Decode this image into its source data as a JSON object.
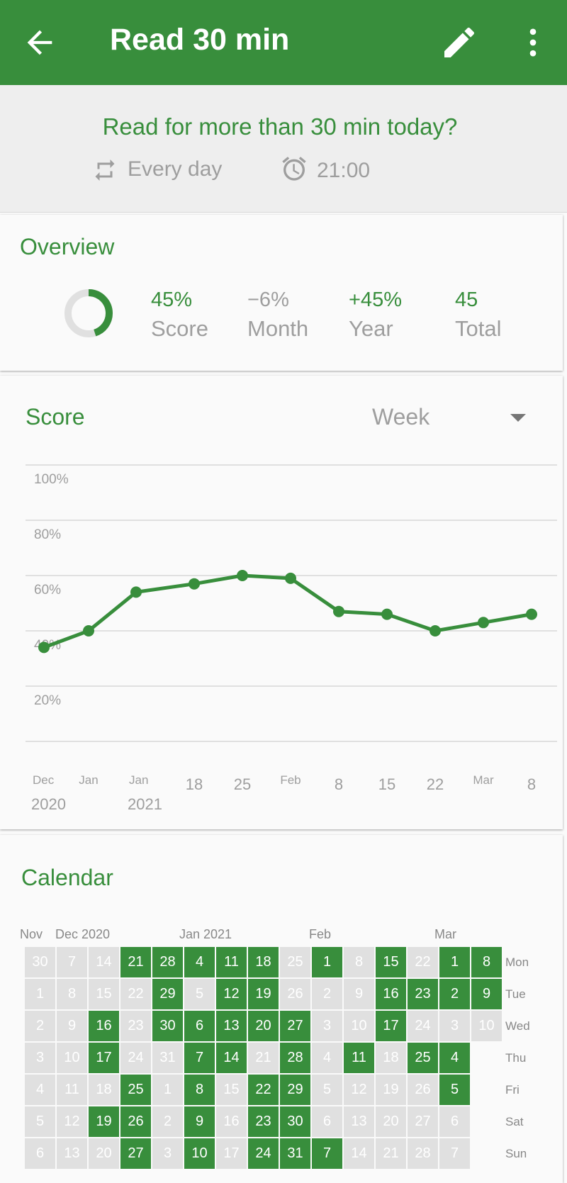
{
  "appbar": {
    "title": "Read 30 min",
    "back_icon": "arrow-left-icon",
    "edit_icon": "pencil-icon",
    "more_icon": "more-vert-icon",
    "color": "#388e3c"
  },
  "question": {
    "text": "Read for more than 30 min today?",
    "frequency": "Every day",
    "reminder_time": "21:00"
  },
  "overview": {
    "title": "Overview",
    "ring_fraction": 0.45,
    "stats": [
      {
        "value": "45%",
        "label": "Score",
        "color": "#388e3c"
      },
      {
        "value": "−6%",
        "label": "Month",
        "color": "#9e9e9e"
      },
      {
        "value": "+45%",
        "label": "Year",
        "color": "#388e3c"
      },
      {
        "value": "45",
        "label": "Total",
        "color": "#388e3c"
      }
    ]
  },
  "score": {
    "title": "Score",
    "period": "Week"
  },
  "chart_data": {
    "type": "line",
    "title": "Score",
    "ylim": [
      0,
      100
    ],
    "yticks": [
      "100%",
      "80%",
      "60%",
      "40%",
      "20%"
    ],
    "x": [
      "Dec 2020",
      "Jan",
      "Jan 2021",
      "18",
      "25",
      "Feb",
      "8",
      "15",
      "22",
      "Mar",
      "8"
    ],
    "xtick_labels": [
      {
        "top": "Dec",
        "bottom": "2020"
      },
      {
        "top": "Jan",
        "bottom": ""
      },
      {
        "top": "Jan",
        "bottom": "2021"
      },
      {
        "top": "18",
        "bottom": ""
      },
      {
        "top": "25",
        "bottom": ""
      },
      {
        "top": "Feb",
        "bottom": ""
      },
      {
        "top": "8",
        "bottom": ""
      },
      {
        "top": "15",
        "bottom": ""
      },
      {
        "top": "22",
        "bottom": ""
      },
      {
        "top": "Mar",
        "bottom": ""
      },
      {
        "top": "8",
        "bottom": ""
      }
    ],
    "series": [
      {
        "values": [
          34,
          40,
          54,
          57,
          60,
          59,
          47,
          46,
          40,
          43,
          46
        ]
      }
    ],
    "grid": true,
    "color": "#388e3c"
  },
  "calendar": {
    "title": "Calendar",
    "months": [
      "Nov",
      "Dec 2020",
      "Jan 2021",
      "Feb",
      "Mar"
    ],
    "weekdays": [
      "Mon",
      "Tue",
      "Wed",
      "Thu",
      "Fri",
      "Sat",
      "Sun"
    ],
    "weeks": [
      [
        [
          "30",
          0
        ],
        [
          "1",
          0
        ],
        [
          "2",
          0
        ],
        [
          "3",
          0
        ],
        [
          "4",
          0
        ],
        [
          "5",
          0
        ],
        [
          "6",
          0
        ]
      ],
      [
        [
          "7",
          0
        ],
        [
          "8",
          0
        ],
        [
          "9",
          0
        ],
        [
          "10",
          0
        ],
        [
          "11",
          0
        ],
        [
          "12",
          0
        ],
        [
          "13",
          0
        ]
      ],
      [
        [
          "14",
          0
        ],
        [
          "15",
          0
        ],
        [
          "16",
          1
        ],
        [
          "17",
          1
        ],
        [
          "18",
          0
        ],
        [
          "19",
          1
        ],
        [
          "20",
          0
        ]
      ],
      [
        [
          "21",
          1
        ],
        [
          "22",
          0
        ],
        [
          "23",
          0
        ],
        [
          "24",
          0
        ],
        [
          "25",
          1
        ],
        [
          "26",
          1
        ],
        [
          "27",
          1
        ]
      ],
      [
        [
          "28",
          1
        ],
        [
          "29",
          1
        ],
        [
          "30",
          1
        ],
        [
          "31",
          0
        ],
        [
          "1",
          0
        ],
        [
          "2",
          0
        ],
        [
          "3",
          0
        ]
      ],
      [
        [
          "4",
          1
        ],
        [
          "5",
          0
        ],
        [
          "6",
          1
        ],
        [
          "7",
          1
        ],
        [
          "8",
          1
        ],
        [
          "9",
          1
        ],
        [
          "10",
          1
        ]
      ],
      [
        [
          "11",
          1
        ],
        [
          "12",
          1
        ],
        [
          "13",
          1
        ],
        [
          "14",
          1
        ],
        [
          "15",
          0
        ],
        [
          "16",
          0
        ],
        [
          "17",
          0
        ]
      ],
      [
        [
          "18",
          1
        ],
        [
          "19",
          1
        ],
        [
          "20",
          1
        ],
        [
          "21",
          0
        ],
        [
          "22",
          1
        ],
        [
          "23",
          1
        ],
        [
          "24",
          1
        ]
      ],
      [
        [
          "25",
          0
        ],
        [
          "26",
          0
        ],
        [
          "27",
          1
        ],
        [
          "28",
          1
        ],
        [
          "29",
          1
        ],
        [
          "30",
          1
        ],
        [
          "31",
          1
        ]
      ],
      [
        [
          "1",
          1
        ],
        [
          "2",
          0
        ],
        [
          "3",
          0
        ],
        [
          "4",
          0
        ],
        [
          "5",
          0
        ],
        [
          "6",
          0
        ],
        [
          "7",
          1
        ]
      ],
      [
        [
          "8",
          0
        ],
        [
          "9",
          0
        ],
        [
          "10",
          0
        ],
        [
          "11",
          1
        ],
        [
          "12",
          0
        ],
        [
          "13",
          0
        ],
        [
          "14",
          0
        ]
      ],
      [
        [
          "15",
          1
        ],
        [
          "16",
          1
        ],
        [
          "17",
          1
        ],
        [
          "18",
          0
        ],
        [
          "19",
          0
        ],
        [
          "20",
          0
        ],
        [
          "21",
          0
        ]
      ],
      [
        [
          "22",
          0
        ],
        [
          "23",
          1
        ],
        [
          "24",
          0
        ],
        [
          "25",
          1
        ],
        [
          "26",
          0
        ],
        [
          "27",
          0
        ],
        [
          "28",
          0
        ]
      ],
      [
        [
          "1",
          1
        ],
        [
          "2",
          1
        ],
        [
          "3",
          0
        ],
        [
          "4",
          1
        ],
        [
          "5",
          1
        ],
        [
          "6",
          0
        ],
        [
          "7",
          0
        ]
      ],
      [
        [
          "8",
          1
        ],
        [
          "9",
          1
        ],
        [
          "10",
          0
        ]
      ]
    ]
  }
}
